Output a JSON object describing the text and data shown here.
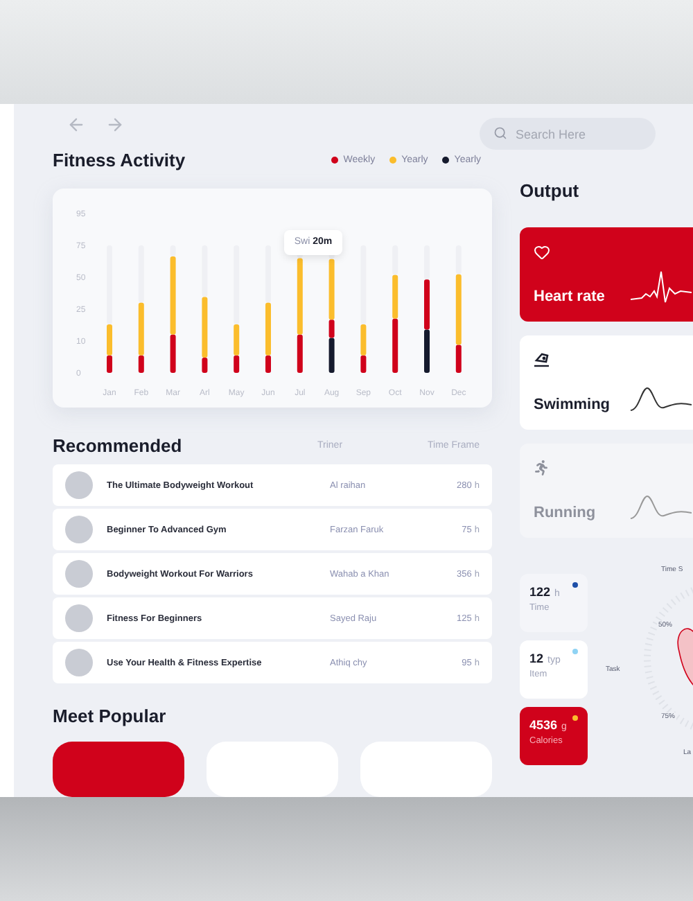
{
  "search": {
    "placeholder": "Search Here"
  },
  "activity": {
    "title": "Fitness Activity",
    "legend": [
      {
        "label": "Weekly",
        "color": "#d0021b"
      },
      {
        "label": "Yearly",
        "color": "#fbbd2c"
      },
      {
        "label": "Yearly",
        "color": "#151a2d"
      }
    ],
    "y_labels": [
      "95",
      "75",
      "50",
      "25",
      "10",
      "0"
    ],
    "months": [
      "Jan",
      "Feb",
      "Mar",
      "Arl",
      "May",
      "Jun",
      "Jul",
      "Aug",
      "Sep",
      "Oct",
      "Nov",
      "Dec"
    ],
    "tooltip": "Swi **20m**"
  },
  "recommended": {
    "title": "Recommended",
    "columns": [
      "Triner",
      "Time Frame"
    ],
    "rows": [
      {
        "title": "The Ultimate Bodyweight Workout",
        "trainer": "Al raihan",
        "time": "280",
        "unit": "h"
      },
      {
        "title": "Beginner To Advanced Gym",
        "trainer": "Farzan Faruk",
        "time": "75",
        "unit": "h"
      },
      {
        "title": "Bodyweight Workout For Warriors",
        "trainer": "Wahab a Khan",
        "time": "356",
        "unit": "h"
      },
      {
        "title": "Fitness For Beginners",
        "trainer": "Sayed Raju",
        "time": "125",
        "unit": "h"
      },
      {
        "title": "Use Your Health & Fitness Expertise",
        "trainer": "Athiq chy",
        "time": "95",
        "unit": "h"
      }
    ]
  },
  "popular": {
    "title": "Meet Popular",
    "cards": [
      {
        "selected": true
      },
      {
        "selected": false
      },
      {
        "selected": false
      }
    ]
  },
  "output": {
    "title": "Output",
    "cards": [
      {
        "kind": "heart",
        "label": "Heart rate",
        "selected": true,
        "dimmed": false
      },
      {
        "kind": "swim",
        "label": "Swimming",
        "selected": false,
        "dimmed": false
      },
      {
        "kind": "run",
        "label": "Running",
        "selected": false,
        "dimmed": true
      }
    ]
  },
  "stats": [
    {
      "kind": "plain",
      "value": "122",
      "unit": "h",
      "label": "Time",
      "color": "#1e4fa8"
    },
    {
      "kind": "card",
      "value": "12",
      "unit": "typ",
      "label": "Item",
      "color": "#8fd3f4"
    },
    {
      "kind": "highlight",
      "value": "4536",
      "unit": "g",
      "label": "Calories",
      "color": "#fbbd2c"
    }
  ],
  "radar": {
    "labels": [
      "Time S",
      "Task",
      "50%",
      "75%",
      "La"
    ]
  }
}
